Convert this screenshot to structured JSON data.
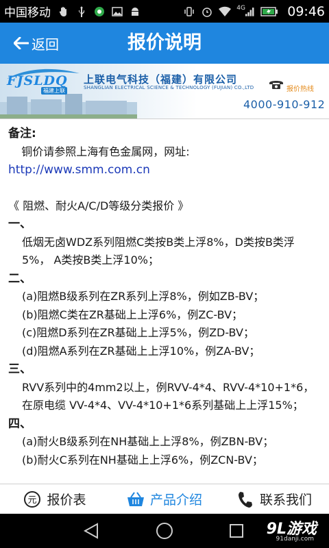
{
  "status_bar": {
    "carrier": "中国移动",
    "network": "4G",
    "time": "09:46"
  },
  "header": {
    "back_label": "返回",
    "title": "报价说明"
  },
  "banner": {
    "logo_text": "FJSLDQ",
    "logo_sub": "福建上联",
    "company_cn": "上联电气科技（福建）有限公司",
    "company_en": "SHANGLIAN ELECTRICAL SCIENCE & TECHNOLOGY (FUJIAN) CO.,LTD",
    "hotline_label": "报价热线",
    "hotline_number": "4000-910-912"
  },
  "content": {
    "notes_title": "备注:",
    "copper_note": "铜价请参照上海有色金属网，网址:",
    "link": "http://www.smm.com.cn",
    "section_header": "《 阻燃、耐火A/C/D等级分类报价 》",
    "sections": [
      {
        "num": "一、",
        "lines": [
          "低烟无卤WDZ系列阻燃C类按B类上浮8%，D类按B类浮5%， A类按B类上浮10%；"
        ]
      },
      {
        "num": "二、",
        "lines": [
          "(a)阻燃B级系列在ZR系列上浮8%，例如ZB-BV；",
          "(b)阻燃C类在ZR基础上上浮6%，例ZC-BV；",
          "(c)阻燃D系列在ZR基础上上浮5%，例ZD-BV；",
          "(d)阻燃A系列在ZR基础上上浮10%，例ZA-BV；"
        ]
      },
      {
        "num": "三、",
        "lines": [
          "RVV系列中的4mm2以上，例RVV-4*4、RVV-4*10+1*6，在原电缆 VV-4*4、VV-4*10+1*6系列基础上上浮15%；"
        ]
      },
      {
        "num": "四、",
        "lines": [
          "(a)耐火B级系列在NH基础上上浮8%，例ZBN-BV；",
          "(b)耐火C系列在NH基础上上浮6%，例ZCN-BV；"
        ]
      }
    ]
  },
  "tabs": [
    {
      "label": "报价表",
      "icon": "yuan-coin-icon"
    },
    {
      "label": "产品介绍",
      "icon": "basket-icon"
    },
    {
      "label": "联系我们",
      "icon": "phone-icon"
    }
  ],
  "colors": {
    "title_bar": "#1f86df",
    "active_tab": "#1f86df",
    "link": "#1b39b8",
    "hotline": "#e48a1a"
  },
  "watermark": {
    "main": "9L游戏",
    "url": "91danji.com"
  }
}
